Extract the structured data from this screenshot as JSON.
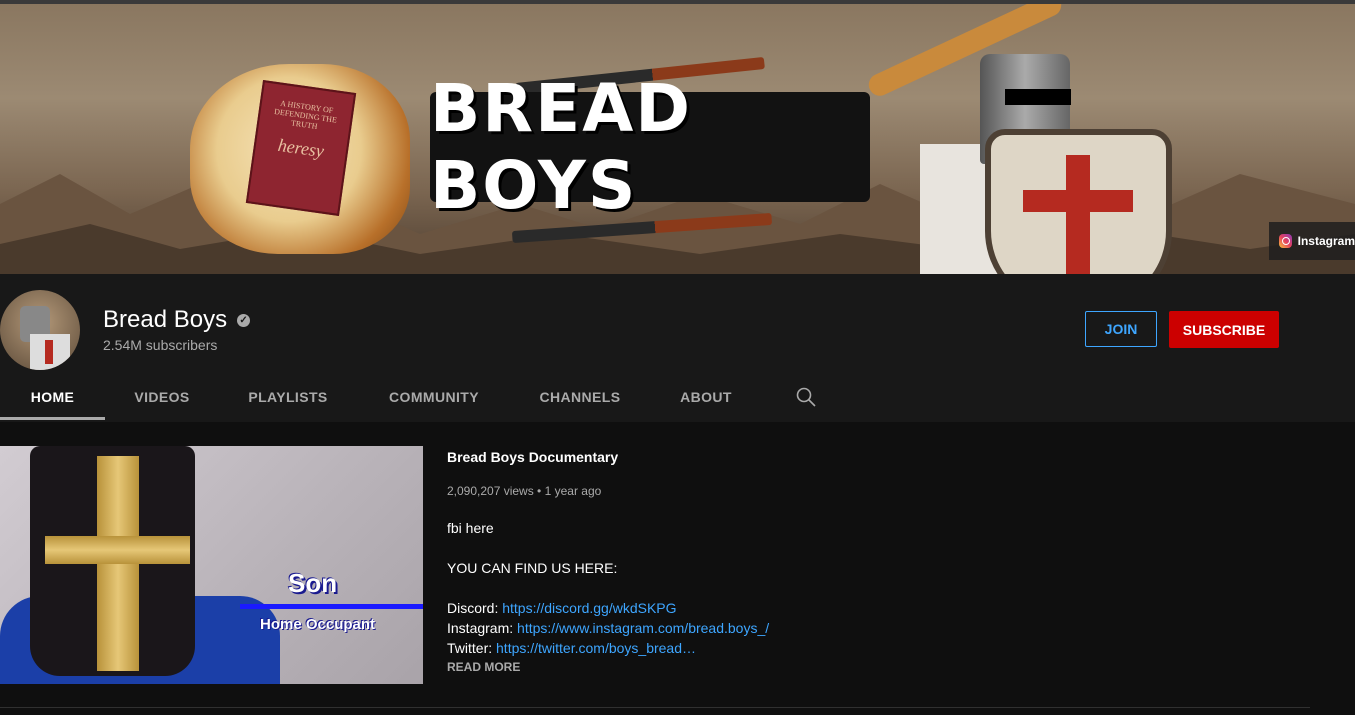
{
  "banner": {
    "title_art": "BREAD BOYS",
    "book_title": "heresy",
    "book_subtitle": "A HISTORY OF DEFENDING THE TRUTH",
    "link_chip": "Instagram"
  },
  "channel": {
    "name": "Bread Boys",
    "subscribers": "2.54M subscribers",
    "join_label": "JOIN",
    "subscribe_label": "SUBSCRIBE"
  },
  "tabs": [
    {
      "label": "HOME",
      "active": true
    },
    {
      "label": "VIDEOS"
    },
    {
      "label": "PLAYLISTS"
    },
    {
      "label": "COMMUNITY"
    },
    {
      "label": "CHANNELS"
    },
    {
      "label": "ABOUT"
    }
  ],
  "featured": {
    "title": "Bread Boys Documentary",
    "meta": "2,090,207 views • 1 year ago",
    "thumb_son": "Son",
    "thumb_home": "Home Occupant",
    "desc_line1": "fbi here",
    "desc_line2": "YOU CAN FIND US HERE:",
    "discord_label": "Discord: ",
    "discord_url": "https://discord.gg/wkdSKPG",
    "instagram_label": "Instagram: ",
    "instagram_url": "https://www.instagram.com/bread.boys_/",
    "twitter_label": "Twitter: ",
    "twitter_url": "https://twitter.com/boys_bread…",
    "read_more": "READ MORE"
  },
  "colors": {
    "background": "#0f0f0f",
    "header_bg": "#181818",
    "subscribe_red": "#cc0000",
    "link_blue": "#3ea6ff"
  }
}
